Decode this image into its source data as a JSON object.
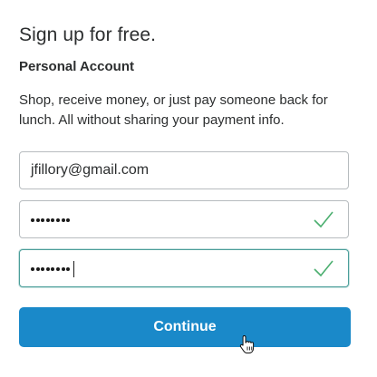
{
  "form": {
    "title": "Sign up for free.",
    "account_type": "Personal Account",
    "description": "Shop, receive money, or just pay someone back for lunch. All without sharing your payment info.",
    "email_value": "jfillory@gmail.com",
    "password_mask": "••••••••",
    "confirm_mask": "••••••••",
    "continue_label": "Continue"
  },
  "icons": {
    "check": "check-icon",
    "cursor": "hand-pointer-icon"
  },
  "colors": {
    "button_bg": "#1a89c9",
    "check": "#4caf70",
    "focus_border": "#4b9e9a",
    "text": "#2c2e2f"
  }
}
